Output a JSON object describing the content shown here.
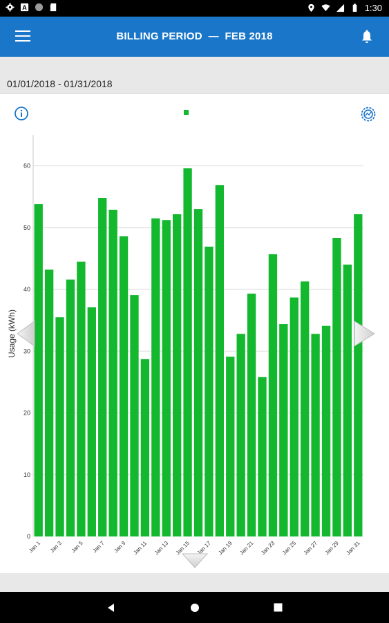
{
  "status_bar": {
    "time": "1:30",
    "left_icons": [
      "settings-icon",
      "notification-a-icon",
      "circle-icon",
      "sd-card-icon"
    ],
    "right_icons": [
      "location-icon",
      "wifi-icon",
      "signal-icon",
      "battery-icon"
    ]
  },
  "app_bar": {
    "title": "BILLING PERIOD  —  FEB 2018",
    "menu_icon": "menu-icon",
    "bell_icon": "bell-icon"
  },
  "date_range": "01/01/2018 - 01/31/2018",
  "chart_controls": {
    "info_icon": "info-icon",
    "settings_icon": "gear-settings-icon",
    "legend_color": "#13b82e"
  },
  "chart_data": {
    "type": "bar",
    "ylabel": "Usage (kWh)",
    "ylim": [
      0,
      65
    ],
    "yticks": [
      0,
      10,
      20,
      30,
      40,
      50,
      60
    ],
    "categories": [
      "Jan 1",
      "Jan 2",
      "Jan 3",
      "Jan 4",
      "Jan 5",
      "Jan 6",
      "Jan 7",
      "Jan 8",
      "Jan 9",
      "Jan 10",
      "Jan 11",
      "Jan 12",
      "Jan 13",
      "Jan 14",
      "Jan 15",
      "Jan 16",
      "Jan 17",
      "Jan 18",
      "Jan 19",
      "Jan 20",
      "Jan 21",
      "Jan 22",
      "Jan 23",
      "Jan 24",
      "Jan 25",
      "Jan 26",
      "Jan 27",
      "Jan 28",
      "Jan 29",
      "Jan 30",
      "Jan 31"
    ],
    "xtick_labels": [
      "Jan 1",
      "Jan 3",
      "Jan 5",
      "Jan 7",
      "Jan 9",
      "Jan 11",
      "Jan 13",
      "Jan 15",
      "Jan 17",
      "Jan 19",
      "Jan 21",
      "Jan 23",
      "Jan 25",
      "Jan 27",
      "Jan 29",
      "Jan 31"
    ],
    "values": [
      53.8,
      43.2,
      35.5,
      41.6,
      44.5,
      37.1,
      54.8,
      52.9,
      48.6,
      39.1,
      28.7,
      51.5,
      51.2,
      52.2,
      59.6,
      53.0,
      46.9,
      56.9,
      29.1,
      32.8,
      39.3,
      25.8,
      45.7,
      34.4,
      38.7,
      41.3,
      32.8,
      34.1,
      48.3,
      44.0,
      52.2
    ],
    "bar_color": "#13b82e",
    "grid": true,
    "legend": "top-center"
  },
  "navigation": {
    "left_arrow": "previous-period-arrow",
    "right_arrow": "next-period-arrow",
    "down_arrow": "expand-down-arrow"
  },
  "system_nav": {
    "back": "back-icon",
    "home": "home-icon",
    "recents": "recents-icon"
  }
}
